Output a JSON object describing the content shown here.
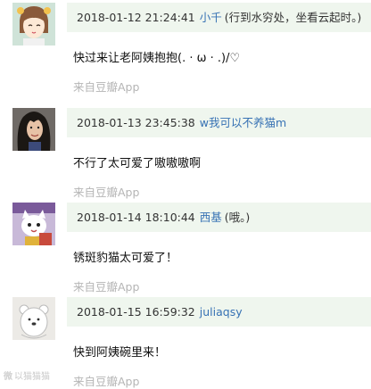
{
  "comments": [
    {
      "avatar": "anime-girl-avatar",
      "timestamp": "2018-01-12 21:24:41",
      "username": "小千",
      "location": "(行到水穷处，坐看云起时。)",
      "text": "快过来让老阿姨抱抱(. · ω · .)/♡",
      "source": "来自豆瓣App"
    },
    {
      "avatar": "woman-photo-avatar",
      "timestamp": "2018-01-13 23:45:38",
      "username": "w我可以不养猫m",
      "location": "",
      "text": "不行了太可爱了嗷嗷嗷啊",
      "source": "来自豆瓣App"
    },
    {
      "avatar": "cartoon-cat-avatar",
      "timestamp": "2018-01-14 18:10:44",
      "username": "西基",
      "location": "(哦。)",
      "text": "锈斑豹猫太可爱了！",
      "source": "来自豆瓣App"
    },
    {
      "avatar": "white-bear-avatar",
      "timestamp": "2018-01-15 16:59:32",
      "username": "juliaqsy",
      "location": "",
      "text": "快到阿姨碗里来！",
      "source": "来自豆瓣App"
    }
  ],
  "watermark": {
    "logo": "weibo-logo-icon",
    "text": "以猫猫猫"
  },
  "colors": {
    "meta_bar_bg": "#eff6ee",
    "username": "#3772b4",
    "source": "#b5b5b5"
  }
}
